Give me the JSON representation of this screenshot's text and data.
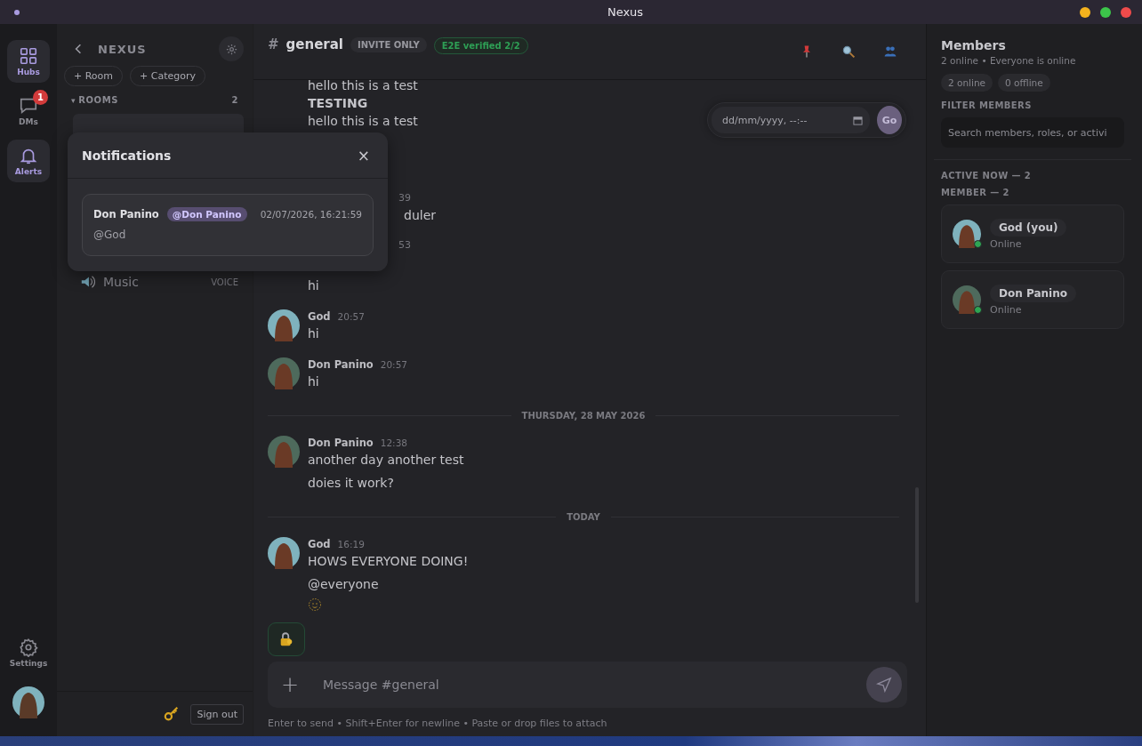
{
  "window": {
    "title": "Nexus"
  },
  "rail": {
    "items": [
      {
        "label": "Hubs",
        "kind": "grid",
        "active": true
      },
      {
        "label": "DMs",
        "kind": "chat",
        "active": false,
        "badge": "1"
      },
      {
        "label": "Alerts",
        "kind": "bell",
        "active": true
      }
    ],
    "settings": {
      "label": "Settings"
    }
  },
  "sidebar": {
    "hub_name": "NEXUS",
    "buttons": [
      "+ Room",
      "+ Category"
    ],
    "section": {
      "toggle": "▾",
      "label": "ROOMS",
      "count": "2"
    },
    "rooms": [
      {
        "name": "Music",
        "type": "VOICE"
      }
    ],
    "sign_out": "Sign out"
  },
  "channel": {
    "hash": "#",
    "name": "general",
    "badges": [
      {
        "label": "INVITE ONLY",
        "kind": "plain"
      },
      {
        "label": "E2E verified 2/2",
        "kind": "verified"
      }
    ]
  },
  "messages": [
    {
      "kind": "line",
      "text": "hello this is a test"
    },
    {
      "kind": "heading",
      "text": "TESTING"
    },
    {
      "kind": "line",
      "text": "hello this is a test"
    },
    {
      "kind": "partial",
      "time": "39",
      "lines": [
        "duler"
      ]
    },
    {
      "kind": "partial",
      "time": "53"
    },
    {
      "kind": "line",
      "text": "hi"
    },
    {
      "kind": "message",
      "author": "God",
      "time": "20:57",
      "color": "#7fb2bd",
      "lines": [
        "hi"
      ]
    },
    {
      "kind": "message",
      "author": "Don Panino",
      "time": "20:57",
      "color": "#4e6a5c",
      "lines": [
        "hi"
      ]
    },
    {
      "kind": "divider",
      "text": "THURSDAY, 28 MAY 2026"
    },
    {
      "kind": "message",
      "author": "Don Panino",
      "time": "12:38",
      "color": "#4e6a5c",
      "lines": [
        "another day another test",
        "doies it work?"
      ]
    },
    {
      "kind": "divider",
      "text": "TODAY"
    },
    {
      "kind": "message",
      "author": "God",
      "time": "16:19",
      "color": "#7fb2bd",
      "lines": [
        "HOWS EVERYONE DOING!",
        "@everyone"
      ],
      "reaction": true
    }
  ],
  "schedule": {
    "placeholder": "dd/mm/yyyy, --:--",
    "button": "Go"
  },
  "composer": {
    "placeholder": "Message #general",
    "plus": "+",
    "hint": "Enter to send • Shift+Enter for newline • Paste or drop files to attach"
  },
  "notifications": {
    "title": "Notifications",
    "close": "×",
    "items": [
      {
        "author": "Don Panino",
        "mention": "@Don Panino",
        "time": "02/07/2026, 16:21:59",
        "text": "@God"
      }
    ]
  },
  "members": {
    "title": "Members",
    "subtitle": "2 online • Everyone is online",
    "chips": [
      "2 online",
      "0 offline"
    ],
    "filter_label": "FILTER MEMBERS",
    "search": {
      "placeholder": "Search members, roles, or activi"
    },
    "groups": [
      "ACTIVE NOW — 2",
      "MEMBER — 2"
    ],
    "list": [
      {
        "name": "God (you)",
        "status": "Online",
        "color": "#7fb2bd",
        "online": true
      },
      {
        "name": "Don Panino",
        "status": "Online",
        "color": "#4e6a5c",
        "online": true
      }
    ]
  }
}
